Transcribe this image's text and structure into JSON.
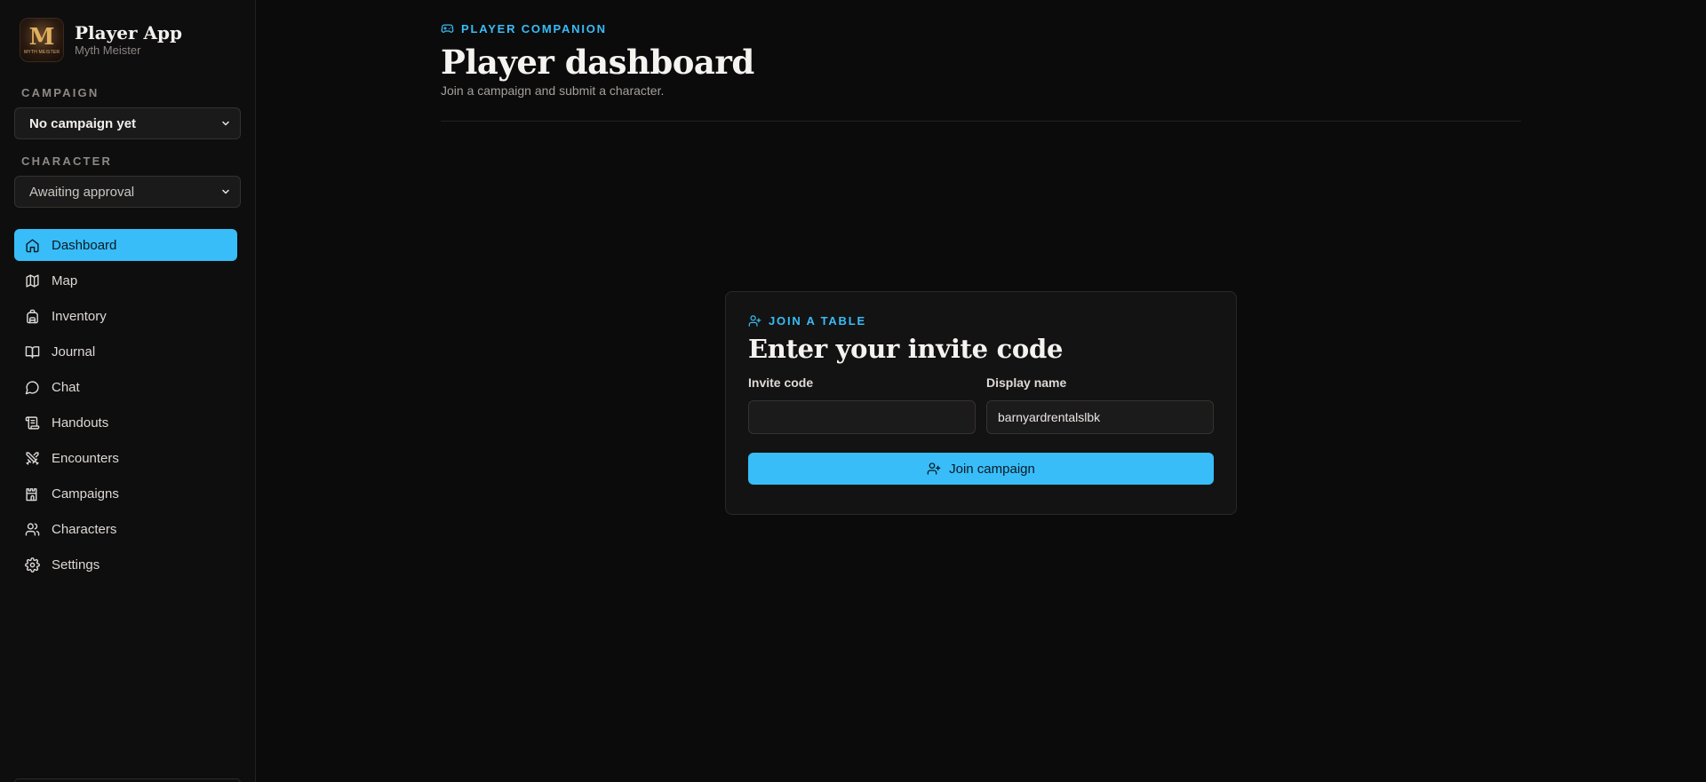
{
  "brand": {
    "title": "Player App",
    "subtitle": "Myth Meister",
    "logo_letter": "M",
    "logo_tagline": "MYTH MEISTER"
  },
  "sidebar": {
    "campaign_label": "CAMPAIGN",
    "campaign_value": "No campaign yet",
    "character_label": "CHARACTER",
    "character_value": "Awaiting approval",
    "items": [
      {
        "label": "Dashboard",
        "icon": "home-icon",
        "active": true
      },
      {
        "label": "Map",
        "icon": "map-icon"
      },
      {
        "label": "Inventory",
        "icon": "backpack-icon"
      },
      {
        "label": "Journal",
        "icon": "book-open-icon"
      },
      {
        "label": "Chat",
        "icon": "message-circle-icon"
      },
      {
        "label": "Handouts",
        "icon": "scroll-icon"
      },
      {
        "label": "Encounters",
        "icon": "swords-icon"
      },
      {
        "label": "Campaigns",
        "icon": "castle-icon"
      },
      {
        "label": "Characters",
        "icon": "users-icon"
      },
      {
        "label": "Settings",
        "icon": "gear-icon"
      }
    ]
  },
  "header": {
    "eyebrow": "PLAYER COMPANION",
    "title": "Player dashboard",
    "subtitle": "Join a campaign and submit a character."
  },
  "join_card": {
    "eyebrow": "JOIN A TABLE",
    "title": "Enter your invite code",
    "invite_label": "Invite code",
    "invite_value": "",
    "display_label": "Display name",
    "display_value": "barnyardrentalslbk",
    "button_label": "Join campaign"
  },
  "colors": {
    "accent": "#38bdf8",
    "background": "#0c0b0b",
    "sidebar": "#0f0e0e",
    "card": "#141313"
  }
}
